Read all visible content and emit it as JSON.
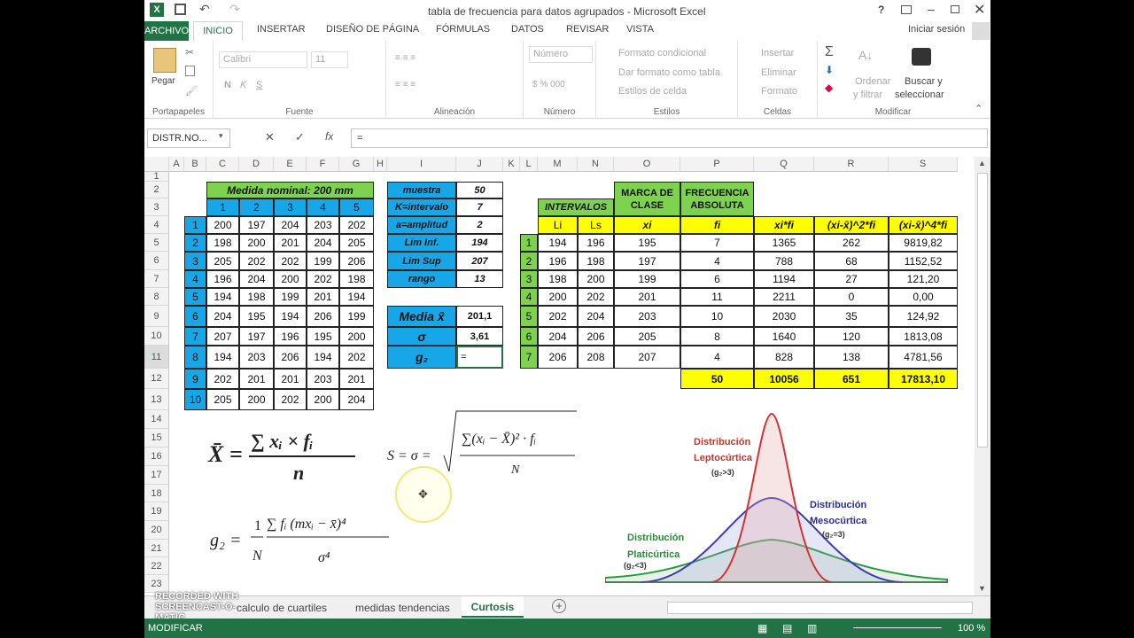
{
  "title": "tabla de frecuencia para datos agrupados - Microsoft Excel",
  "tabs": [
    "ARCHIVO",
    "INICIO",
    "INSERTAR",
    "DISEÑO DE PÁGINA",
    "FÓRMULAS",
    "DATOS",
    "REVISAR",
    "VISTA"
  ],
  "signin": "Iniciar sesión",
  "ribbon": {
    "paste": "Pegar",
    "font_name": "Calibri",
    "font_size": "11",
    "number_format": "Número",
    "cond_format": "Formato condicional",
    "table_format": "Dar formato como tabla",
    "cell_styles": "Estilos de celda",
    "insert": "Insertar",
    "delete": "Eliminar",
    "format": "Formato",
    "sort": "Ordenar",
    "sort2": "y filtrar",
    "find": "Buscar y",
    "find2": "seleccionar",
    "groups": [
      "Portapapeles",
      "Fuente",
      "Alineación",
      "Número",
      "Estilos",
      "Celdas",
      "Modificar"
    ]
  },
  "formula_bar": {
    "name_box": "DISTR.NO...",
    "formula": "="
  },
  "columns": [
    "A",
    "B",
    "C",
    "D",
    "E",
    "F",
    "G",
    "H",
    "I",
    "J",
    "K",
    "L",
    "M",
    "N",
    "O",
    "P",
    "Q",
    "R",
    "S"
  ],
  "rows": [
    "1",
    "2",
    "3",
    "4",
    "5",
    "6",
    "7",
    "8",
    "9",
    "10",
    "11",
    "12",
    "13",
    "14",
    "15",
    "16",
    "17",
    "18",
    "19",
    "20",
    "21",
    "22",
    "23"
  ],
  "data_table": {
    "title": "Medida nominal: 200 mm",
    "headers": [
      "1",
      "2",
      "3",
      "4",
      "5"
    ],
    "row_labels": [
      "1",
      "2",
      "3",
      "4",
      "5",
      "6",
      "7",
      "8",
      "9",
      "10"
    ],
    "values": [
      [
        "200",
        "197",
        "204",
        "203",
        "202"
      ],
      [
        "198",
        "200",
        "201",
        "204",
        "205"
      ],
      [
        "205",
        "202",
        "202",
        "199",
        "206"
      ],
      [
        "196",
        "204",
        "200",
        "202",
        "198"
      ],
      [
        "194",
        "198",
        "199",
        "201",
        "194"
      ],
      [
        "204",
        "195",
        "194",
        "206",
        "199"
      ],
      [
        "207",
        "197",
        "196",
        "195",
        "200"
      ],
      [
        "194",
        "203",
        "206",
        "194",
        "202"
      ],
      [
        "202",
        "201",
        "201",
        "203",
        "201"
      ],
      [
        "205",
        "200",
        "202",
        "200",
        "204"
      ]
    ]
  },
  "params": [
    {
      "label": "muestra",
      "value": "50"
    },
    {
      "label": "K=intervalo",
      "value": "7"
    },
    {
      "label": "a=amplitud",
      "value": "2"
    },
    {
      "label": "Lim Inf.",
      "value": "194"
    },
    {
      "label": "Lim Sup",
      "value": "207"
    },
    {
      "label": "rango",
      "value": "13"
    }
  ],
  "stats": [
    {
      "label": "Media  x̄",
      "value": "201,1"
    },
    {
      "label": "σ",
      "value": "3,61"
    },
    {
      "label": "g₂",
      "value": "="
    }
  ],
  "freq_table": {
    "group_intervals": "INTERVALOS",
    "group_marca": "MARCA DE CLASE",
    "group_freq": "FRECUENCIA ABSOLUTA",
    "headers": [
      "Li",
      "Ls",
      "xi",
      "fi",
      "xi*fi",
      "(xi-x̄)^2*fi",
      "(xi-x̄)^4*fi"
    ],
    "row_labels": [
      "1",
      "2",
      "3",
      "4",
      "5",
      "6",
      "7"
    ],
    "rows": [
      [
        "194",
        "196",
        "195",
        "7",
        "1365",
        "262",
        "9819,82"
      ],
      [
        "196",
        "198",
        "197",
        "4",
        "788",
        "68",
        "1152,52"
      ],
      [
        "198",
        "200",
        "199",
        "6",
        "1194",
        "27",
        "121,20"
      ],
      [
        "200",
        "202",
        "201",
        "11",
        "2211",
        "0",
        "0,00"
      ],
      [
        "202",
        "204",
        "203",
        "10",
        "2030",
        "35",
        "124,92"
      ],
      [
        "204",
        "206",
        "205",
        "8",
        "1640",
        "120",
        "1813,08"
      ],
      [
        "206",
        "208",
        "207",
        "4",
        "828",
        "138",
        "4781,56"
      ]
    ],
    "totals": [
      "50",
      "10056",
      "651",
      "17813,10"
    ]
  },
  "curves": {
    "lepto": "Distribución",
    "lepto2": "Leptocúrtica",
    "lepto3": "(g₂>3)",
    "meso": "Distribución",
    "meso2": "Mesocúrtica",
    "meso3": "(g₂=3)",
    "plati": "Distribución",
    "plati2": "Platicúrtica",
    "plati3": "(g₂<3)"
  },
  "sheets": [
    "calculo de cuartiles",
    "medidas tendencias",
    "Curtosis"
  ],
  "status": {
    "mode": "MODIFICAR",
    "zoom": "100 %"
  },
  "watermark": "RECORDED WITH SCREENCAST-O-MATIC",
  "colors": {
    "blue": "#17a7e8",
    "green": "#7dd34d",
    "yellow": "#ffff00",
    "excel_green": "#217346"
  }
}
